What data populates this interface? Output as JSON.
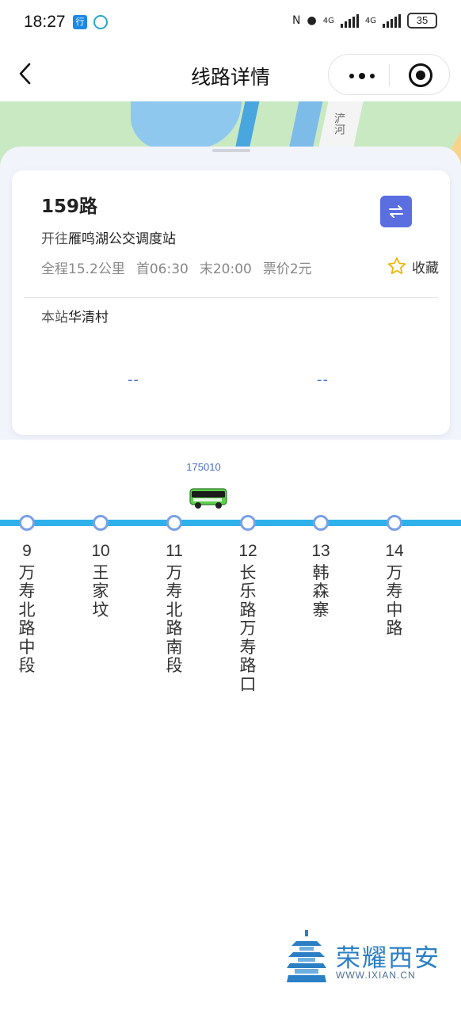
{
  "status_bar": {
    "time": "18:27",
    "app_icon_1": "行",
    "nfc_label": "N",
    "net1": "4G",
    "net2": "4G",
    "battery": "35"
  },
  "nav": {
    "title": "线路详情",
    "back_icon": "chevron-left-icon",
    "more_icon": "more-dots-icon",
    "close_icon": "target-icon"
  },
  "map": {
    "road_label": "浐河"
  },
  "route": {
    "name": "159路",
    "toward_prefix": "开往",
    "destination": "雁鸣湖公交调度站",
    "distance": "全程15.2公里",
    "first_bus": "首06:30",
    "last_bus": "末20:00",
    "fare": "票价2元",
    "favorite_label": "收藏",
    "current_prefix": "本站",
    "current_station": "华清村",
    "eta_1": "--",
    "eta_2": "--"
  },
  "bus": {
    "id": "175010"
  },
  "stops": [
    {
      "num": "9",
      "name": "万寿北路中段"
    },
    {
      "num": "10",
      "name": "王家坟"
    },
    {
      "num": "11",
      "name": "万寿北路南段"
    },
    {
      "num": "12",
      "name": "长乐路万寿路口"
    },
    {
      "num": "13",
      "name": "韩森寨"
    },
    {
      "num": "14",
      "name": "万寿中路"
    }
  ],
  "watermark": {
    "title": "荣耀西安",
    "url": "WWW.IXIAN.CN"
  },
  "colors": {
    "accent": "#5a6ee0",
    "track": "#2eb0ea",
    "bus": "#5ccf4b"
  }
}
